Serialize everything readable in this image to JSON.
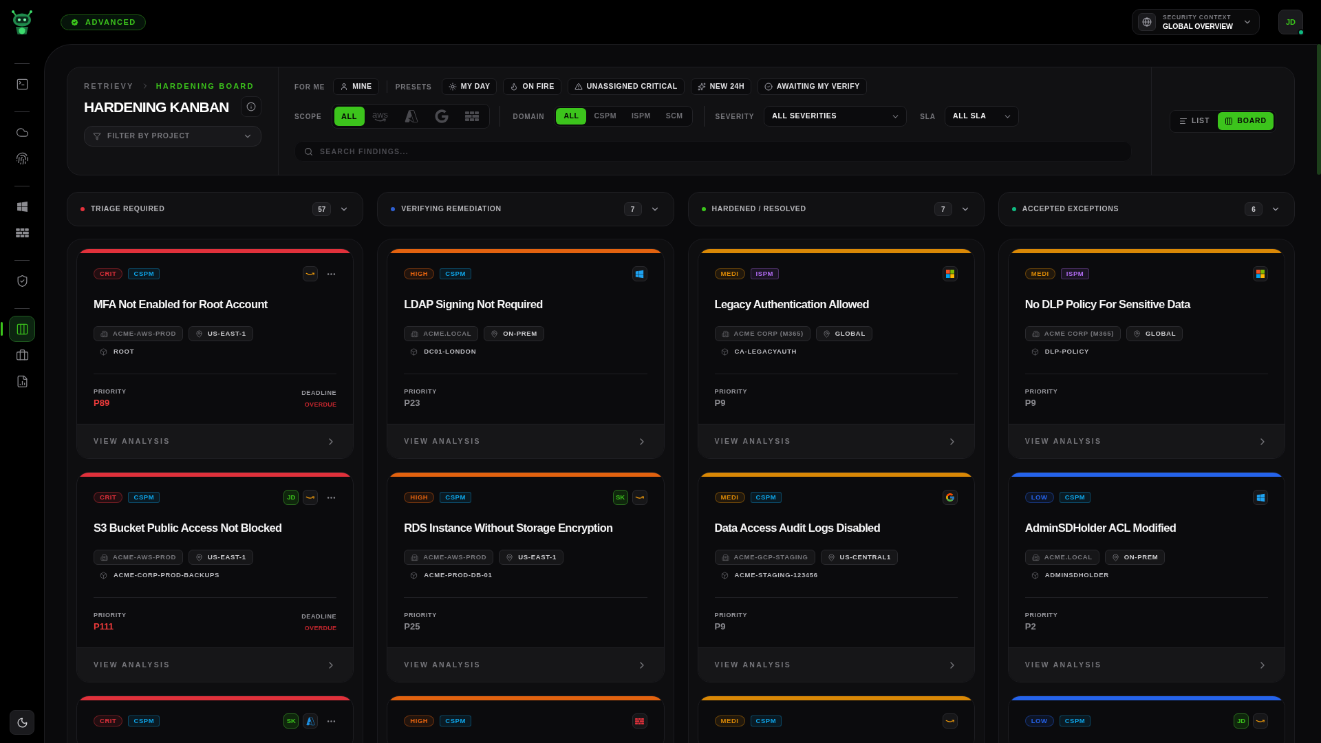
{
  "header": {
    "level_badge": "ADVANCED",
    "security_context": {
      "label": "SECURITY CONTEXT",
      "value": "GLOBAL OVERVIEW"
    },
    "user": {
      "initials": "JD",
      "online": true
    }
  },
  "sidebar": {
    "groups": [
      {
        "items": [
          {
            "selected": false
          }
        ]
      },
      {
        "items": [
          {
            "selected": false
          },
          {
            "selected": false
          }
        ]
      },
      {
        "items": [
          {
            "selected": false
          },
          {
            "selected": false
          }
        ]
      },
      {
        "items": [
          {
            "selected": false
          }
        ]
      },
      {
        "items": [
          {
            "selected": true
          },
          {
            "selected": false
          },
          {
            "selected": false
          }
        ]
      }
    ]
  },
  "board_header": {
    "breadcrumb": [
      "RETRIEVY",
      "HARDENING BOARD"
    ],
    "title": "HARDENING KANBAN",
    "project_filter": {
      "placeholder": "FILTER BY PROJECT"
    }
  },
  "filters": {
    "for_me": {
      "label": "FOR ME",
      "chips": [
        {
          "label": "MINE",
          "selected": false
        }
      ]
    },
    "presets": {
      "label": "PRESETS",
      "chips": [
        {
          "label": "MY DAY",
          "selected": false
        },
        {
          "label": "ON FIRE",
          "selected": false
        },
        {
          "label": "UNASSIGNED CRITICAL",
          "selected": false
        },
        {
          "label": "NEW 24H",
          "selected": false
        },
        {
          "label": "AWAITING MY VERIFY",
          "selected": false
        }
      ]
    },
    "scope": {
      "label": "SCOPE",
      "options": [
        {
          "kind": "text",
          "label": "ALL",
          "selected": true
        },
        {
          "kind": "aws",
          "label": "aws",
          "selected": false
        },
        {
          "kind": "azure",
          "selected": false
        },
        {
          "kind": "gcp",
          "selected": false
        },
        {
          "kind": "fortinet",
          "selected": false
        }
      ]
    },
    "domain": {
      "label": "DOMAIN",
      "options": [
        {
          "label": "ALL",
          "selected": true
        },
        {
          "label": "CSPM",
          "selected": false
        },
        {
          "label": "ISPM",
          "selected": false
        },
        {
          "label": "SCM",
          "selected": false
        }
      ]
    },
    "severity": {
      "label": "SEVERITY",
      "value": "ALL SEVERITIES"
    },
    "sla": {
      "label": "SLA",
      "value": "ALL SLA"
    },
    "search": {
      "placeholder": "SEARCH FINDINGS..."
    }
  },
  "view_toggle": [
    {
      "label": "LIST",
      "selected": false
    },
    {
      "label": "BOARD",
      "selected": true
    }
  ],
  "columns": [
    {
      "title": "TRIAGE REQUIRED",
      "color": "#e5323c",
      "count": "57",
      "cards": [
        {
          "severity": {
            "label": "CRIT",
            "color": "#e0313b"
          },
          "domain": {
            "label": "CSPM",
            "color": "#0ea5e9"
          },
          "source": {
            "kind": "aws"
          },
          "has_menu": true,
          "title": "MFA Not Enabled for Root Account",
          "account": "ACME-AWS-PROD",
          "region": "US-EAST-1",
          "resource": "ROOT",
          "priority": {
            "label": "PRIORITY",
            "value": "P89"
          },
          "deadline": {
            "label": "DEADLINE",
            "value": "OVERDUE"
          },
          "action": "VIEW ANALYSIS"
        },
        {
          "severity": {
            "label": "CRIT",
            "color": "#e0313b"
          },
          "domain": {
            "label": "CSPM",
            "color": "#0ea5e9"
          },
          "assignee": "JD",
          "source": {
            "kind": "aws"
          },
          "has_menu": true,
          "title": "S3 Bucket Public Access Not Blocked",
          "account": "ACME-AWS-PROD",
          "region": "US-EAST-1",
          "resource": "ACME-CORP-PROD-BACKUPS",
          "priority": {
            "label": "PRIORITY",
            "value": "P111"
          },
          "deadline": {
            "label": "DEADLINE",
            "value": "OVERDUE"
          },
          "action": "VIEW ANALYSIS"
        },
        {
          "severity": {
            "label": "CRIT",
            "color": "#e0313b"
          },
          "domain": {
            "label": "CSPM",
            "color": "#0ea5e9"
          },
          "assignee": "SK",
          "source": {
            "kind": "azure"
          },
          "has_menu": true
        }
      ]
    },
    {
      "title": "VERIFYING REMEDIATION",
      "color": "#2f5fd0",
      "count": "7",
      "cards": [
        {
          "severity": {
            "label": "HIGH",
            "color": "#e2620f"
          },
          "domain": {
            "label": "CSPM",
            "color": "#0ea5e9"
          },
          "source": {
            "kind": "windows"
          },
          "has_menu": false,
          "title": "LDAP Signing Not Required",
          "account": "ACME.LOCAL",
          "region": "ON-PREM",
          "resource": "DC01-LONDON",
          "priority": {
            "label": "PRIORITY",
            "value": "P23"
          },
          "action": "VIEW ANALYSIS"
        },
        {
          "severity": {
            "label": "HIGH",
            "color": "#e2620f"
          },
          "domain": {
            "label": "CSPM",
            "color": "#0ea5e9"
          },
          "assignee": "SK",
          "source": {
            "kind": "aws"
          },
          "has_menu": false,
          "title": "RDS Instance Without Storage Encryption",
          "account": "ACME-AWS-PROD",
          "region": "US-EAST-1",
          "resource": "ACME-PROD-DB-01",
          "priority": {
            "label": "PRIORITY",
            "value": "P25"
          },
          "action": "VIEW ANALYSIS"
        },
        {
          "severity": {
            "label": "HIGH",
            "color": "#e2620f"
          },
          "domain": {
            "label": "CSPM",
            "color": "#0ea5e9"
          },
          "source": {
            "kind": "fortinet"
          },
          "has_menu": false
        }
      ]
    },
    {
      "title": "HARDENED / RESOLVED",
      "color": "#3cc41c",
      "count": "7",
      "cards": [
        {
          "severity": {
            "label": "MEDI",
            "color": "#d98806"
          },
          "domain": {
            "label": "ISPM",
            "color": "#b36cf5"
          },
          "source": {
            "kind": "microsoft"
          },
          "has_menu": false,
          "title": "Legacy Authentication Allowed",
          "account": "ACME CORP (M365)",
          "region": "GLOBAL",
          "resource": "CA-LEGACYAUTH",
          "priority": {
            "label": "PRIORITY",
            "value": "P9"
          },
          "action": "VIEW ANALYSIS"
        },
        {
          "severity": {
            "label": "MEDI",
            "color": "#d98806"
          },
          "domain": {
            "label": "CSPM",
            "color": "#0ea5e9"
          },
          "source": {
            "kind": "gcp"
          },
          "has_menu": false,
          "title": "Data Access Audit Logs Disabled",
          "account": "ACME-GCP-STAGING",
          "region": "US-CENTRAL1",
          "resource": "ACME-STAGING-123456",
          "priority": {
            "label": "PRIORITY",
            "value": "P9"
          },
          "action": "VIEW ANALYSIS"
        },
        {
          "severity": {
            "label": "MEDI",
            "color": "#d98806"
          },
          "domain": {
            "label": "CSPM",
            "color": "#0ea5e9"
          },
          "source": {
            "kind": "aws"
          },
          "has_menu": false
        }
      ]
    },
    {
      "title": "ACCEPTED EXCEPTIONS",
      "color": "#10b981",
      "count": "6",
      "cards": [
        {
          "severity": {
            "label": "MEDI",
            "color": "#d98806"
          },
          "domain": {
            "label": "ISPM",
            "color": "#b36cf5"
          },
          "source": {
            "kind": "microsoft"
          },
          "has_menu": false,
          "title": "No DLP Policy For Sensitive Data",
          "account": "ACME CORP (M365)",
          "region": "GLOBAL",
          "resource": "DLP-POLICY",
          "priority": {
            "label": "PRIORITY",
            "value": "P9"
          },
          "action": "VIEW ANALYSIS"
        },
        {
          "severity": {
            "label": "LOW",
            "color": "#2563eb"
          },
          "domain": {
            "label": "CSPM",
            "color": "#0ea5e9"
          },
          "source": {
            "kind": "windows"
          },
          "has_menu": false,
          "title": "AdminSDHolder ACL Modified",
          "account": "ACME.LOCAL",
          "region": "ON-PREM",
          "resource": "ADMINSDHOLDER",
          "priority": {
            "label": "PRIORITY",
            "value": "P2"
          },
          "action": "VIEW ANALYSIS"
        },
        {
          "severity": {
            "label": "LOW",
            "color": "#2563eb"
          },
          "domain": {
            "label": "CSPM",
            "color": "#0ea5e9"
          },
          "assignee": "JD",
          "source": {
            "kind": "aws"
          },
          "has_menu": false
        }
      ]
    }
  ]
}
